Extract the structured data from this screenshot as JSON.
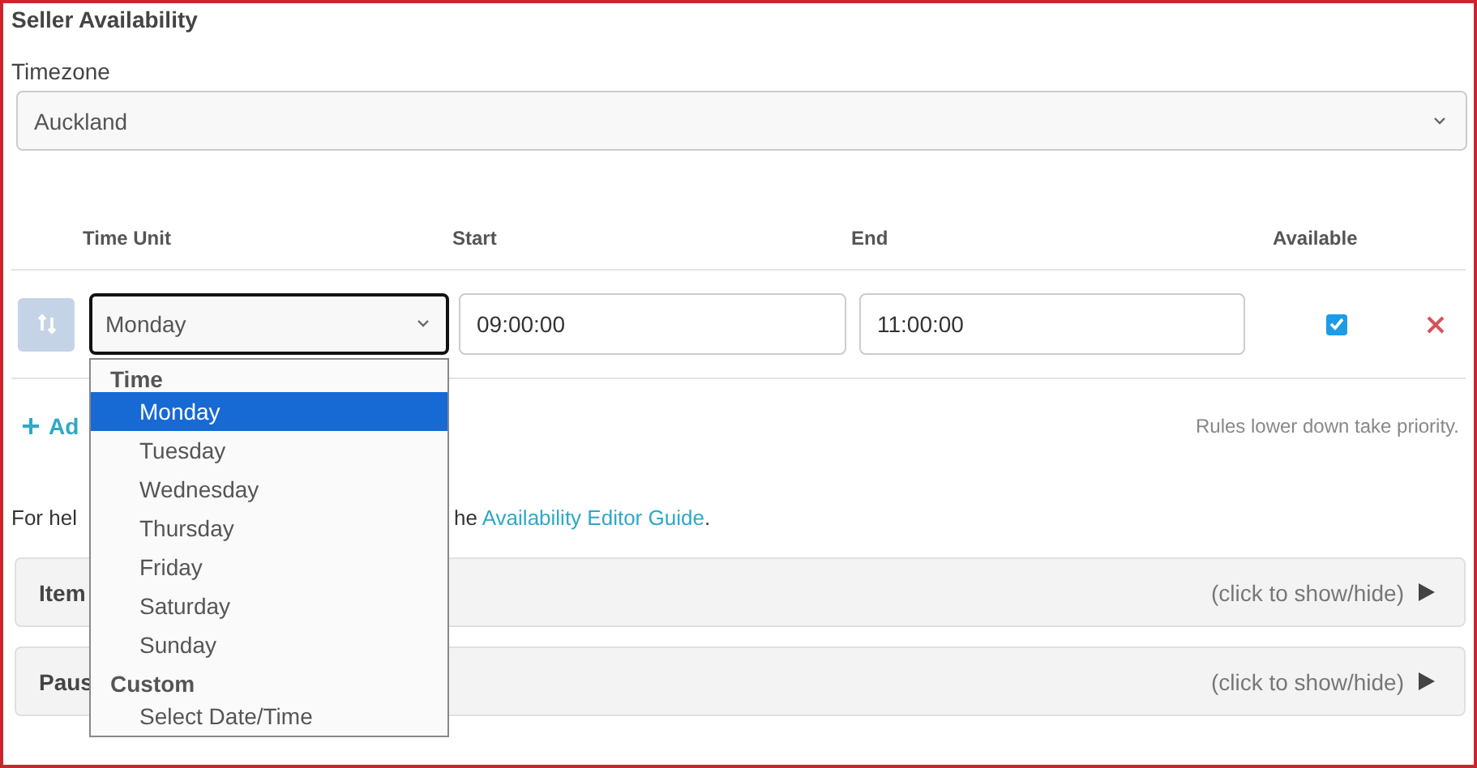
{
  "title": "Seller Availability",
  "timezone": {
    "label": "Timezone",
    "value": "Auckland"
  },
  "table": {
    "columns": [
      "Time Unit",
      "Start",
      "End",
      "Available"
    ],
    "rows": [
      {
        "time_unit": "Monday",
        "start": "09:00:00",
        "end": "11:00:00",
        "available": true,
        "focused": true
      }
    ]
  },
  "add_button": "Ad",
  "priority_note": "Rules lower down take priority.",
  "help": {
    "start": "For hel",
    "end": "he",
    "link": "Availability Editor Guide",
    "tail": "."
  },
  "panels": [
    {
      "label": "Item",
      "hint": "(click to show/hide)",
      "expanded": false
    },
    {
      "label": "Paus",
      "hint": "(click to show/hide)",
      "expanded": false
    }
  ],
  "dropdown": {
    "groups": [
      {
        "label": "Time",
        "options": [
          {
            "label": "Monday",
            "selected": true
          },
          {
            "label": "Tuesday",
            "selected": false
          },
          {
            "label": "Wednesday",
            "selected": false
          },
          {
            "label": "Thursday",
            "selected": false
          },
          {
            "label": "Friday",
            "selected": false
          },
          {
            "label": "Saturday",
            "selected": false
          },
          {
            "label": "Sunday",
            "selected": false
          }
        ]
      },
      {
        "label": "Custom",
        "options": [
          {
            "label": "Select Date/Time",
            "selected": false
          }
        ]
      }
    ]
  }
}
